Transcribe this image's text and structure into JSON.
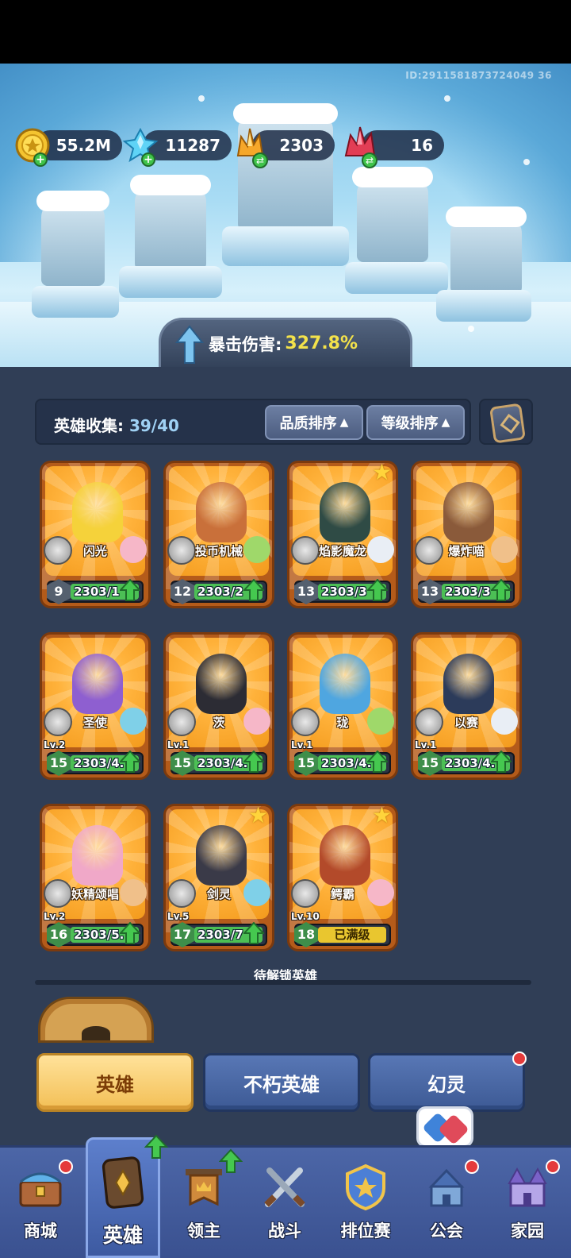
{
  "header": {
    "player_id": "ID:2911581873724049 36"
  },
  "resources": [
    {
      "name": "gold",
      "value": "55.2M",
      "icon": "gold-coin-icon",
      "action": "plus"
    },
    {
      "name": "crystal",
      "value": "11287",
      "icon": "blue-crystal-icon",
      "action": "plus"
    },
    {
      "name": "amber",
      "value": "2303",
      "icon": "orange-crystal-icon",
      "action": "swap"
    },
    {
      "name": "ruby",
      "value": "16",
      "icon": "red-crystal-icon",
      "action": "swap"
    }
  ],
  "bonus": {
    "label": "暴击伤害:",
    "value": "327.8%"
  },
  "collection": {
    "label": "英雄收集:",
    "count": "39/40",
    "sort_quality": "品质排序",
    "sort_level": "等级排序"
  },
  "heroes": [
    {
      "name": "闪光",
      "level": "9",
      "progress": "2303/1",
      "lv": "",
      "star": false,
      "portrait_color": "#f5d23a"
    },
    {
      "name": "投币机械",
      "level": "12",
      "progress": "2303/2",
      "lv": "",
      "star": false,
      "portrait_color": "#c9703a"
    },
    {
      "name": "焰影魔龙",
      "level": "13",
      "progress": "2303/3",
      "lv": "",
      "star": true,
      "portrait_color": "#2f4b45"
    },
    {
      "name": "爆炸喵",
      "level": "13",
      "progress": "2303/3",
      "lv": "",
      "star": false,
      "portrait_color": "#8a5a3a"
    },
    {
      "name": "圣使",
      "level": "15",
      "progress": "2303/4.",
      "lv": "Lv.2",
      "star": false,
      "portrait_color": "#8e5fd0"
    },
    {
      "name": "茨",
      "level": "15",
      "progress": "2303/4.",
      "lv": "Lv.1",
      "star": false,
      "portrait_color": "#2c2c34"
    },
    {
      "name": "珑",
      "level": "15",
      "progress": "2303/4.",
      "lv": "Lv.1",
      "star": false,
      "portrait_color": "#4fa6e0"
    },
    {
      "name": "以赛",
      "level": "15",
      "progress": "2303/4.",
      "lv": "Lv.1",
      "star": false,
      "portrait_color": "#2c3b5a"
    },
    {
      "name": "妖精颂唱",
      "level": "16",
      "progress": "2303/5.",
      "lv": "Lv.2",
      "star": false,
      "portrait_color": "#f0a8c8"
    },
    {
      "name": "剑灵",
      "level": "17",
      "progress": "2303/7",
      "lv": "Lv.5",
      "star": true,
      "portrait_color": "#3a3a48"
    },
    {
      "name": "鳄霸",
      "level": "18",
      "progress": "",
      "maxed": "已满级",
      "lv": "Lv.10",
      "star": true,
      "portrait_color": "#b34a2a"
    }
  ],
  "locked_section": {
    "title": "待解锁英雄"
  },
  "tabs": [
    {
      "label": "英雄",
      "active": true
    },
    {
      "label": "不朽英雄",
      "active": false
    },
    {
      "label": "幻灵",
      "active": false
    }
  ],
  "nav": [
    {
      "label": "商城",
      "icon": "shop-chest-icon"
    },
    {
      "label": "英雄",
      "icon": "hero-card-icon"
    },
    {
      "label": "领主",
      "icon": "lord-banner-icon"
    },
    {
      "label": "战斗",
      "icon": "crossed-swords-icon"
    },
    {
      "label": "排位赛",
      "icon": "ranked-shield-icon"
    },
    {
      "label": "公会",
      "icon": "guild-castle-icon"
    },
    {
      "label": "家园",
      "icon": "home-castle-icon"
    }
  ],
  "colors": {
    "panel": "#303e56",
    "gold_text": "#f3e24b",
    "card_orange": "#ffb23b",
    "progress_green": "#4cbf55",
    "nav_blue": "#4c66a7"
  }
}
